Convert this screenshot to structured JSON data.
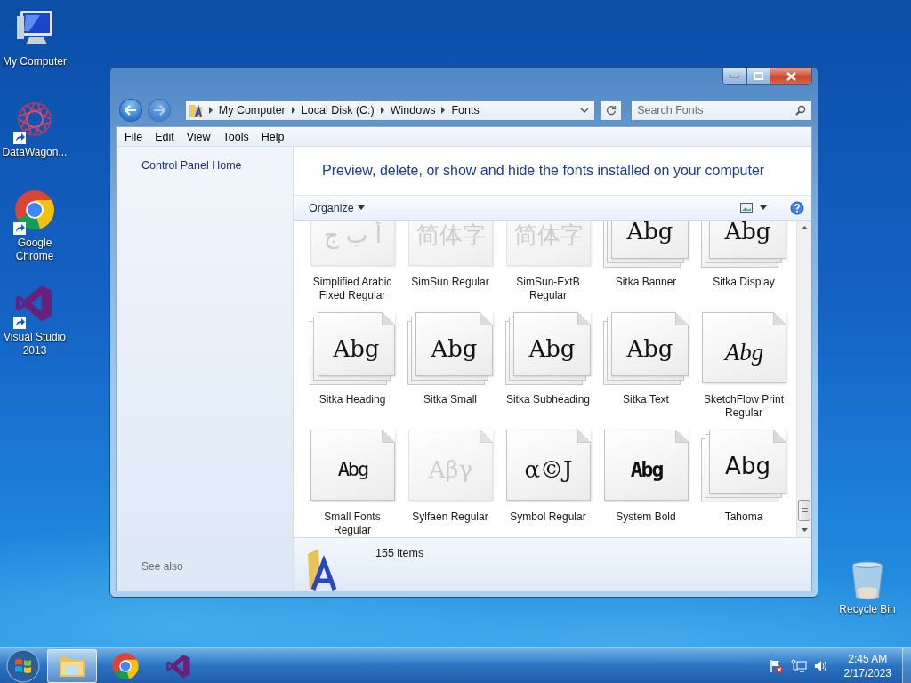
{
  "desktop_icons": [
    {
      "label": "My Computer",
      "kind": "computer",
      "shortcut": false
    },
    {
      "label": "DataWagon...",
      "kind": "network",
      "shortcut": true
    },
    {
      "label": "Google Chrome",
      "kind": "chrome",
      "shortcut": true
    },
    {
      "label": "Visual Studio 2013",
      "kind": "vs",
      "shortcut": true
    }
  ],
  "recycle_bin": {
    "label": "Recycle Bin"
  },
  "window": {
    "nav": {
      "back_disabled": false,
      "forward_disabled": true
    },
    "breadcrumb": [
      "My Computer",
      "Local Disk (C:)",
      "Windows",
      "Fonts"
    ],
    "search": {
      "placeholder": "Search Fonts"
    },
    "menu": [
      "File",
      "Edit",
      "View",
      "Tools",
      "Help"
    ],
    "left_pane": {
      "link": "Control Panel Home",
      "see_also": "See also"
    },
    "heading": "Preview, delete, or show and hide the fonts installed on your computer",
    "toolbar": {
      "organize": "Organize"
    },
    "fonts": [
      {
        "name": "Simplified Arabic Fixed Regular",
        "sample": "أ ب ج",
        "kind": "sans",
        "stacked": false,
        "hidden": true
      },
      {
        "name": "SimSun Regular",
        "sample": "简体字",
        "kind": "serif",
        "stacked": false,
        "hidden": true
      },
      {
        "name": "SimSun-ExtB Regular",
        "sample": "简体字",
        "kind": "serif",
        "stacked": false,
        "hidden": true
      },
      {
        "name": "Sitka Banner",
        "sample": "Abg",
        "kind": "serif",
        "stacked": true,
        "hidden": false
      },
      {
        "name": "Sitka Display",
        "sample": "Abg",
        "kind": "serif",
        "stacked": true,
        "hidden": false
      },
      {
        "name": "Sitka Heading",
        "sample": "Abg",
        "kind": "serif",
        "stacked": true,
        "hidden": false
      },
      {
        "name": "Sitka Small",
        "sample": "Abg",
        "kind": "serif",
        "stacked": true,
        "hidden": false
      },
      {
        "name": "Sitka Subheading",
        "sample": "Abg",
        "kind": "serif",
        "stacked": true,
        "hidden": false
      },
      {
        "name": "Sitka Text",
        "sample": "Abg",
        "kind": "serif",
        "stacked": true,
        "hidden": false
      },
      {
        "name": "SketchFlow Print Regular",
        "sample": "Abg",
        "kind": "script",
        "stacked": false,
        "hidden": false
      },
      {
        "name": "Small Fonts Regular",
        "sample": "Abg",
        "kind": "pixel",
        "stacked": false,
        "hidden": false
      },
      {
        "name": "Sylfaen Regular",
        "sample": "Aβγ",
        "kind": "serif",
        "stacked": false,
        "hidden": true
      },
      {
        "name": "Symbol Regular",
        "sample": "α©J",
        "kind": "serif",
        "stacked": false,
        "hidden": false
      },
      {
        "name": "System Bold",
        "sample": "Abg",
        "kind": "pixelbold",
        "stacked": false,
        "hidden": false
      },
      {
        "name": "Tahoma",
        "sample": "Abg",
        "kind": "sans",
        "stacked": true,
        "hidden": false
      }
    ],
    "status": "155 items"
  },
  "taskbar": {
    "apps": [
      {
        "kind": "explorer",
        "selected": true
      },
      {
        "kind": "chrome",
        "selected": false
      },
      {
        "kind": "vs",
        "selected": false
      }
    ],
    "clock": {
      "time": "2:45 AM",
      "date": "2/17/2023"
    }
  }
}
